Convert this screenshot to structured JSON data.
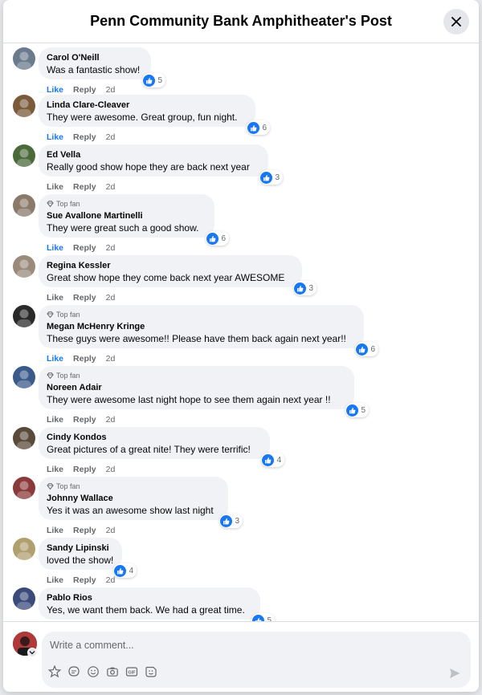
{
  "header": {
    "title": "Penn Community Bank Amphitheater's Post"
  },
  "comments": [
    {
      "author": "Carol O'Neill",
      "text": "Was a fantastic show!",
      "top_fan": false,
      "likes": "5",
      "liked": true,
      "time": "2d",
      "avatar_color": "#6b7a8c"
    },
    {
      "author": "Linda Clare-Cleaver",
      "text": "They were awesome. Great group, fun night.",
      "top_fan": false,
      "likes": "6",
      "liked": true,
      "time": "2d",
      "avatar_color": "#7a5a3a"
    },
    {
      "author": "Ed Vella",
      "text": "Really good show hope they are back next year",
      "top_fan": false,
      "likes": "3",
      "liked": false,
      "time": "2d",
      "avatar_color": "#4a6a3a"
    },
    {
      "author": "Sue Avallone Martinelli",
      "text": "They were great such a good show.",
      "top_fan": true,
      "likes": "6",
      "liked": true,
      "time": "2d",
      "avatar_color": "#8a7a6a"
    },
    {
      "author": "Regina Kessler",
      "text": "Great show hope they come back next year AWESOME",
      "top_fan": false,
      "likes": "3",
      "liked": false,
      "time": "2d",
      "avatar_color": "#9a8a7a"
    },
    {
      "author": "Megan McHenry Kringe",
      "text": "These guys were awesome!! Please have them back again next year!!",
      "top_fan": true,
      "likes": "6",
      "liked": true,
      "time": "2d",
      "avatar_color": "#2a2a2a"
    },
    {
      "author": "Noreen Adair",
      "text": "They were awesome last night hope to see them again next year !!",
      "top_fan": true,
      "likes": "5",
      "liked": false,
      "time": "2d",
      "avatar_color": "#3a5a8a"
    },
    {
      "author": "Cindy Kondos",
      "text": "Great pictures of a great nite! They were terrific!",
      "top_fan": false,
      "likes": "4",
      "liked": false,
      "time": "2d",
      "avatar_color": "#5a4a3a"
    },
    {
      "author": "Johnny Wallace",
      "text": "Yes it was an awesome show last night",
      "top_fan": true,
      "likes": "3",
      "liked": false,
      "time": "2d",
      "avatar_color": "#8a3a3a"
    },
    {
      "author": "Sandy Lipinski",
      "text": "loved the show!",
      "top_fan": false,
      "likes": "4",
      "liked": false,
      "time": "2d",
      "avatar_color": "#b0a070"
    },
    {
      "author": "Pablo Rios",
      "text": "Yes, we want them back. We had a great time.",
      "top_fan": false,
      "likes": "5",
      "liked": false,
      "time": "",
      "avatar_color": "#3a4a7a"
    }
  ],
  "labels": {
    "like": "Like",
    "reply": "Reply",
    "top_fan": "Top fan"
  },
  "composer": {
    "placeholder": "Write a comment..."
  },
  "colors": {
    "accent": "#1877f2",
    "bubble": "#f0f2f5",
    "muted": "#65676b"
  },
  "icons": {
    "close": "close-icon",
    "like_reaction": "like-reaction-icon",
    "top_fan_badge": "diamond-icon",
    "composer_tools": [
      "avatar-icon",
      "sticker-icon",
      "emoji-icon",
      "camera-icon",
      "gif-icon",
      "sticker-face-icon"
    ],
    "send": "send-icon"
  }
}
